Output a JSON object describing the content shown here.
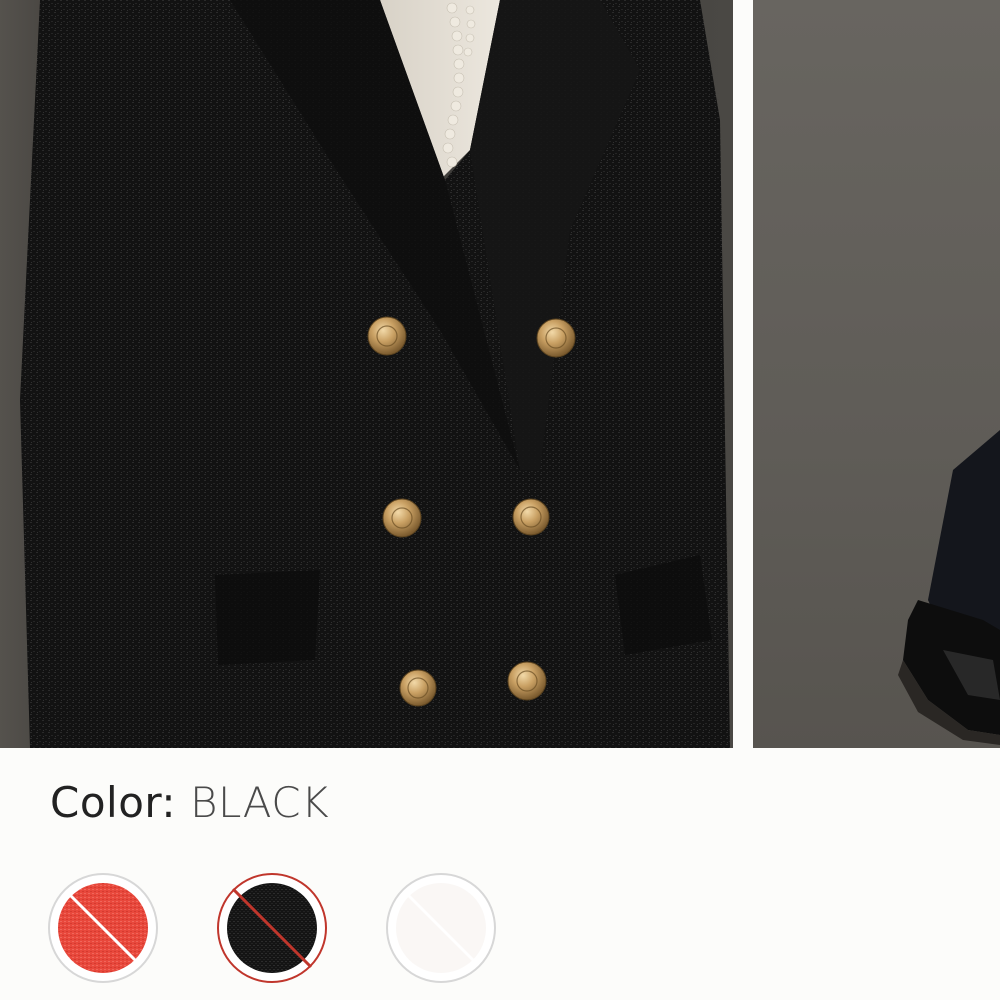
{
  "product_images": {
    "main_image": "black-double-breasted-blazer-photo",
    "next_image": "model-with-black-boots-photo"
  },
  "color_selector": {
    "label": "Color:",
    "selected_value": "BLACK",
    "swatches": [
      {
        "name": "red",
        "fill": "#e8483c",
        "available": false,
        "selected": false
      },
      {
        "name": "black",
        "fill": "#141414",
        "available": false,
        "selected": true,
        "ring_color": "#c0362c"
      },
      {
        "name": "white",
        "fill": "#faf7f5",
        "available": false,
        "selected": false
      }
    ]
  }
}
